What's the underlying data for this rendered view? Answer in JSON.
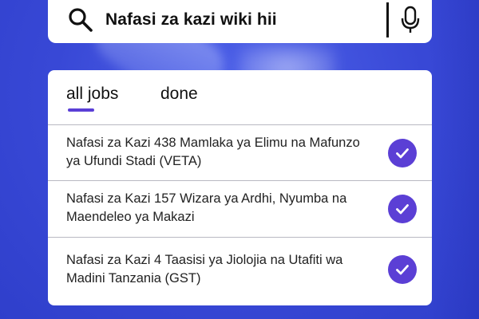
{
  "search": {
    "query": "Nafasi za kazi wiki hii",
    "icons": [
      "search-icon",
      "microphone-icon"
    ]
  },
  "tabs": [
    {
      "label": "all jobs",
      "active": true
    },
    {
      "label": "done",
      "active": false
    }
  ],
  "jobs": [
    {
      "title": "Nafasi za Kazi 438 Mamlaka ya Elimu na Mafunzo ya Ufundi Stadi (VETA)",
      "checked": true
    },
    {
      "title": "Nafasi za Kazi 157 Wizara ya Ardhi, Nyumba na Maendeleo ya Makazi",
      "checked": true
    },
    {
      "title": "Nafasi za Kazi 4 Taasisi ya Jiolojia na Utafiti wa Madini Tanzania (GST)",
      "checked": true
    }
  ],
  "colors": {
    "background": "#3b4fd8",
    "accent": "#5b3fd5",
    "card": "#ffffff"
  }
}
